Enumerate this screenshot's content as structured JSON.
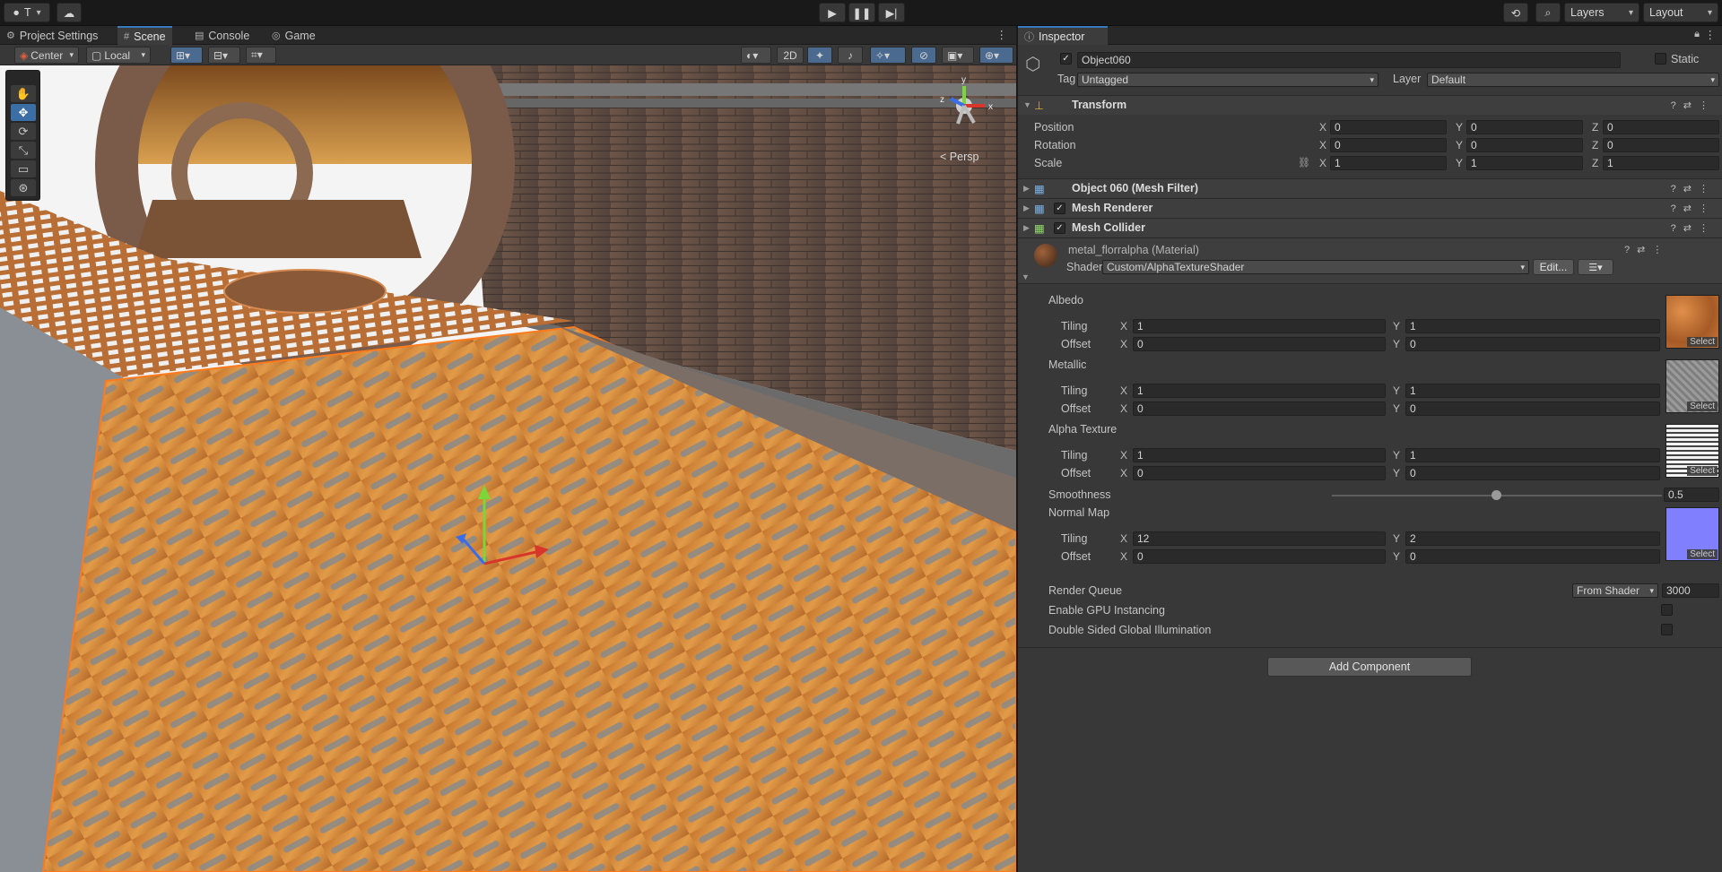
{
  "topbar": {
    "account_label": "T",
    "layers_label": "Layers",
    "layout_label": "Layout"
  },
  "tabs_left": [
    {
      "label": "Project Settings",
      "icon": "gear-icon"
    },
    {
      "label": "Scene",
      "icon": "grid-icon"
    },
    {
      "label": "Console",
      "icon": "list-icon"
    },
    {
      "label": "Game",
      "icon": "gamepad-icon"
    }
  ],
  "scene_toolbar": {
    "pivot_label": "Center",
    "space_label": "Local",
    "mode_2d": "2D"
  },
  "scene_view": {
    "projection_label": "Persp",
    "gizmo_axes": {
      "x": "x",
      "y": "y",
      "z": "z"
    }
  },
  "inspector": {
    "tab_label": "Inspector",
    "object_name": "Object060",
    "static_label": "Static",
    "tag_label": "Tag",
    "tag_value": "Untagged",
    "layer_label": "Layer",
    "layer_value": "Default",
    "transform": {
      "title": "Transform",
      "rows": [
        {
          "label": "Position",
          "x": "0",
          "y": "0",
          "z": "0"
        },
        {
          "label": "Rotation",
          "x": "0",
          "y": "0",
          "z": "0"
        },
        {
          "label": "Scale",
          "x": "1",
          "y": "1",
          "z": "1"
        }
      ]
    },
    "components": [
      {
        "title": "Object 060 (Mesh Filter)",
        "has_checkbox": false
      },
      {
        "title": "Mesh Renderer",
        "has_checkbox": true
      },
      {
        "title": "Mesh Collider",
        "has_checkbox": true
      }
    ],
    "material": {
      "name": "metal_florralpha (Material)",
      "shader_label": "Shader",
      "shader_value": "Custom/AlphaTextureShader",
      "edit_label": "Edit...",
      "textures": [
        {
          "name": "Albedo",
          "tiling_x": "1",
          "tiling_y": "1",
          "offset_x": "0",
          "offset_y": "0",
          "color": "#c06a2c"
        },
        {
          "name": "Metallic",
          "tiling_x": "1",
          "tiling_y": "1",
          "offset_x": "0",
          "offset_y": "0",
          "color": "#8e8e8e"
        },
        {
          "name": "Alpha Texture",
          "tiling_x": "1",
          "tiling_y": "1",
          "offset_x": "0",
          "offset_y": "0",
          "color": "#d9d9d9"
        }
      ],
      "smoothness_label": "Smoothness",
      "smoothness_value": "0.5",
      "normal_map": {
        "name": "Normal Map",
        "tiling_x": "12",
        "tiling_y": "2",
        "offset_x": "0",
        "offset_y": "0",
        "color": "#8080ff"
      },
      "tiling_label": "Tiling",
      "offset_label": "Offset",
      "select_label": "Select",
      "render_queue_label": "Render Queue",
      "render_queue_source": "From Shader",
      "render_queue_value": "3000",
      "gpu_instancing_label": "Enable GPU Instancing",
      "double_sided_gi_label": "Double Sided Global Illumination"
    },
    "add_component_label": "Add Component"
  }
}
